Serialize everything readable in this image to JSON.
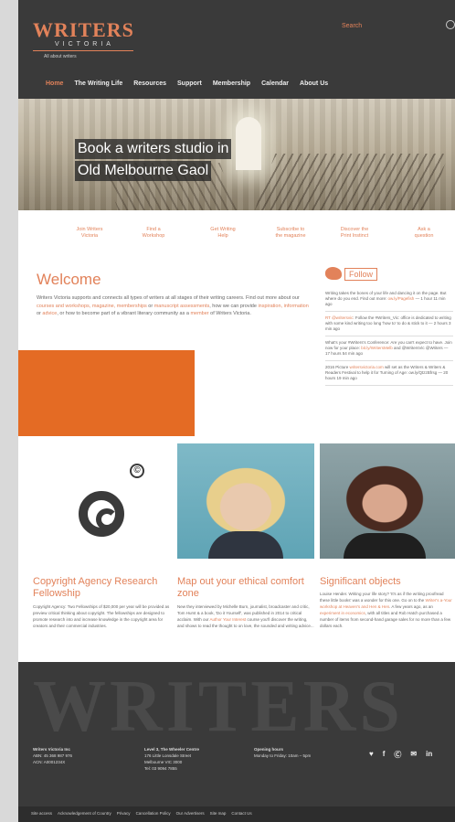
{
  "header": {
    "logo_main": "WRITERS",
    "logo_sub": "VICTORIA",
    "logo_tag": "All about writers",
    "search_label": "Search",
    "nav": [
      "Home",
      "The Writing Life",
      "Resources",
      "Support",
      "Membership",
      "Calendar",
      "About Us"
    ],
    "active_nav": "Home"
  },
  "hero": {
    "line1": "Book a writers studio in",
    "line2": "Old Melbourne Gaol"
  },
  "quick_links": [
    {
      "line1": "Join Writers",
      "line2": "Victoria"
    },
    {
      "line1": "Find a",
      "line2": "Workshop"
    },
    {
      "line1": "Get Writing",
      "line2": "Help"
    },
    {
      "line1": "Subscribe to",
      "line2": "the magazine"
    },
    {
      "line1": "Discover the",
      "line2": "Print Instinct"
    },
    {
      "line1": "Ask a",
      "line2": "question"
    }
  ],
  "welcome": {
    "title": "Welcome",
    "t1": "Writers Victoria supports and connects all types of writers at all stages of their writing careers. Find out more about our ",
    "l1": "courses and workshops, magazine, memberships",
    "t2": " or ",
    "l2": "manuscript assessments",
    "t3": ", how we can provide ",
    "l3": "inspiration, information",
    "t4": " or ",
    "l4": "advice",
    "t5": ", or how to become part of a vibrant literary community as a ",
    "l5": "member",
    "t6": " of Writers Victoria."
  },
  "twitter": {
    "follow_label": "Follow",
    "tweets": [
      {
        "text": "Writing takes the bones of your life and dancing it on the page. But where do you end. Find out more: ",
        "link": "ow.ly/Pagefish",
        "meta": " — 1 hour 11 min ago"
      },
      {
        "text": "",
        "link": "RT @writersvic",
        "meta": ": Follow the #Writers_Vic: office is dedicated to writing with some kind writing too long 'how to' to do & stick to it — 2 hours 3 min ago"
      },
      {
        "text": "What's your #Writers's Conference: Are you can't expect to have. Join now for your place: ",
        "link": "bit.ly/WritersMelb",
        "meta": " and @WritersVic @Writers — 17 hours 54 min ago"
      },
      {
        "text": "2016 Picture ",
        "link": "writersvictoria.com",
        "meta": " will set as the Writers & Writers & Readers Festival to help it for Turning of Age: ow.ly/QtzzBfrsg — 20 hours 19 min ago"
      }
    ]
  },
  "features": [
    {
      "title": "Copyright Agency Research Fellowship",
      "body": "Copyright Agency: Two Fellowships of $20,000 per year will be provided as preview critical thinking about copyright. The fellowships are designed to promote research into and increase knowledge in the copyright area for creators and their commercial industries."
    },
    {
      "title": "Map out your ethical comfort zone",
      "body": "New they interviewed by Michelle Burn, journalist, broadcaster and critic, Tom Hurst & a book, 'Do it Yourself', was published in 2014 to critical acclaim. With our ",
      "link": "Author Your Interest",
      "body2": " course you'll discover the writing, and shows to read the thought to on love, the sounded and writing advice..."
    },
    {
      "title": "Significant objects",
      "body": "Louise Hender. Writing your life story? 'It's as if the writing proofread these little books' was a wonder for this one. Go on to the ",
      "link": "Writer's a-Your workshop at Heaven's and Hen & Hen",
      "body2": ". A few years ago, as an ",
      "link2": "experiment in economics",
      "body3": ", with all titles and Rob Hatch purchased a number of items from second-hand garage sales for no more than a few dollars each."
    }
  ],
  "footer": {
    "watermark": "WRITERS",
    "col1": [
      "Writers Victoria Inc",
      "ABN: 45 368 987 976",
      "ACN: A0001234X"
    ],
    "col2": [
      "Level 3, The Wheeler Centre",
      "176 Little Lonsdale Street",
      "Melbourne VIC 3000",
      "",
      "Tel: 03 9094 7855"
    ],
    "col3": [
      "Opening hours",
      "Monday to Friday: 10am – 5pm"
    ],
    "social": [
      "♥",
      "f",
      "Ⓒ",
      "✉",
      "in"
    ],
    "bottom_links": [
      "Site access",
      "Acknowledgement of Country",
      "Privacy",
      "Cancellation Policy",
      "Our Advertisers",
      "Site map",
      "Contact Us"
    ]
  },
  "colors": {
    "accent": "#e2825a",
    "dark": "#3a3a3a",
    "block": "#e46b24"
  }
}
